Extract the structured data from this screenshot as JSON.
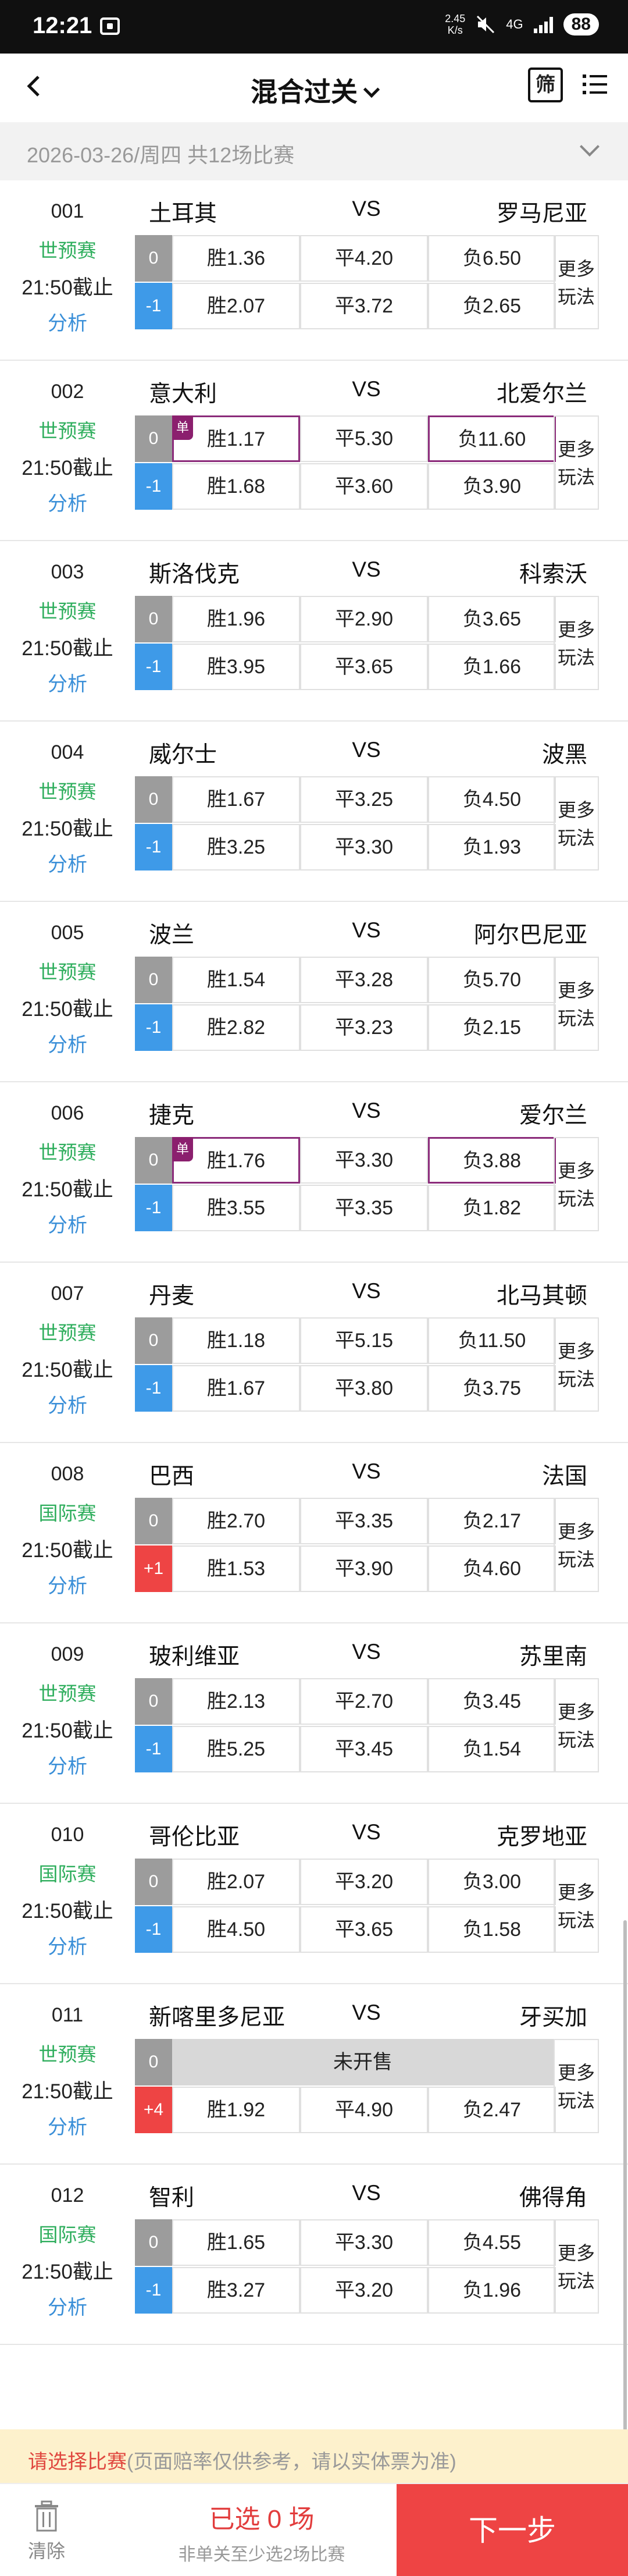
{
  "status_bar": {
    "time": "12:21",
    "speed_value": "2.45",
    "speed_unit": "K/s",
    "network": "4G",
    "battery": "88"
  },
  "header": {
    "title": "混合过关",
    "filter_label": "筛"
  },
  "date_bar": {
    "text": "2026-03-26/周四 共12场比赛"
  },
  "labels": {
    "vs": "VS",
    "more": "更多\n玩法",
    "analysis": "分析",
    "single": "单",
    "not_on_sale": "未开售"
  },
  "matches": [
    {
      "num": "001",
      "league": "世预赛",
      "deadline": "21:50截止",
      "home": "土耳其",
      "away": "罗马尼亚",
      "h1": "0",
      "h2": "-1",
      "o1": [
        "胜1.36",
        "平4.20",
        "负6.50"
      ],
      "o2": [
        "胜2.07",
        "平3.72",
        "负2.65"
      ]
    },
    {
      "num": "002",
      "league": "世预赛",
      "deadline": "21:50截止",
      "home": "意大利",
      "away": "北爱尔兰",
      "h1": "0",
      "h2": "-1",
      "o1": [
        "胜1.17",
        "平5.30",
        "负11.60"
      ],
      "o2": [
        "胜1.68",
        "平3.60",
        "负3.90"
      ]
    },
    {
      "num": "003",
      "league": "世预赛",
      "deadline": "21:50截止",
      "home": "斯洛伐克",
      "away": "科索沃",
      "h1": "0",
      "h2": "-1",
      "o1": [
        "胜1.96",
        "平2.90",
        "负3.65"
      ],
      "o2": [
        "胜3.95",
        "平3.65",
        "负1.66"
      ]
    },
    {
      "num": "004",
      "league": "世预赛",
      "deadline": "21:50截止",
      "home": "威尔士",
      "away": "波黑",
      "h1": "0",
      "h2": "-1",
      "o1": [
        "胜1.67",
        "平3.25",
        "负4.50"
      ],
      "o2": [
        "胜3.25",
        "平3.30",
        "负1.93"
      ]
    },
    {
      "num": "005",
      "league": "世预赛",
      "deadline": "21:50截止",
      "home": "波兰",
      "away": "阿尔巴尼亚",
      "h1": "0",
      "h2": "-1",
      "o1": [
        "胜1.54",
        "平3.28",
        "负5.70"
      ],
      "o2": [
        "胜2.82",
        "平3.23",
        "负2.15"
      ]
    },
    {
      "num": "006",
      "league": "世预赛",
      "deadline": "21:50截止",
      "home": "捷克",
      "away": "爱尔兰",
      "h1": "0",
      "h2": "-1",
      "o1": [
        "胜1.76",
        "平3.30",
        "负3.88"
      ],
      "o2": [
        "胜3.55",
        "平3.35",
        "负1.82"
      ]
    },
    {
      "num": "007",
      "league": "世预赛",
      "deadline": "21:50截止",
      "home": "丹麦",
      "away": "北马其顿",
      "h1": "0",
      "h2": "-1",
      "o1": [
        "胜1.18",
        "平5.15",
        "负11.50"
      ],
      "o2": [
        "胜1.67",
        "平3.80",
        "负3.75"
      ]
    },
    {
      "num": "008",
      "league": "国际赛",
      "deadline": "21:50截止",
      "home": "巴西",
      "away": "法国",
      "h1": "0",
      "h2": "+1",
      "o1": [
        "胜2.70",
        "平3.35",
        "负2.17"
      ],
      "o2": [
        "胜1.53",
        "平3.90",
        "负4.60"
      ]
    },
    {
      "num": "009",
      "league": "世预赛",
      "deadline": "21:50截止",
      "home": "玻利维亚",
      "away": "苏里南",
      "h1": "0",
      "h2": "-1",
      "o1": [
        "胜2.13",
        "平2.70",
        "负3.45"
      ],
      "o2": [
        "胜5.25",
        "平3.45",
        "负1.54"
      ]
    },
    {
      "num": "010",
      "league": "国际赛",
      "deadline": "21:50截止",
      "home": "哥伦比亚",
      "away": "克罗地亚",
      "h1": "0",
      "h2": "-1",
      "o1": [
        "胜2.07",
        "平3.20",
        "负3.00"
      ],
      "o2": [
        "胜4.50",
        "平3.65",
        "负1.58"
      ]
    },
    {
      "num": "011",
      "league": "世预赛",
      "deadline": "21:50截止",
      "home": "新喀里多尼亚",
      "away": "牙买加",
      "h1": "0",
      "h2": "+4",
      "o1": [],
      "o2": [
        "胜1.92",
        "平4.90",
        "负2.47"
      ]
    },
    {
      "num": "012",
      "league": "国际赛",
      "deadline": "21:50截止",
      "home": "智利",
      "away": "佛得角",
      "h1": "0",
      "h2": "-1",
      "o1": [
        "胜1.65",
        "平3.30",
        "负4.55"
      ],
      "o2": [
        "胜3.27",
        "平3.20",
        "负1.96"
      ]
    }
  ],
  "notice": {
    "main": "请选择比赛",
    "sub": "(页面赔率仅供参考，请以实体票为准)"
  },
  "footer": {
    "clear_label": "清除",
    "selected_text": "已选 0 场",
    "hint": "非单关至少选2场比赛",
    "next_label": "下一步"
  },
  "colors": {
    "league_green": "#2fae5d",
    "analysis_blue": "#3a8fd8",
    "accent_red": "#ee4444",
    "single_purple": "#8b1f6e"
  }
}
